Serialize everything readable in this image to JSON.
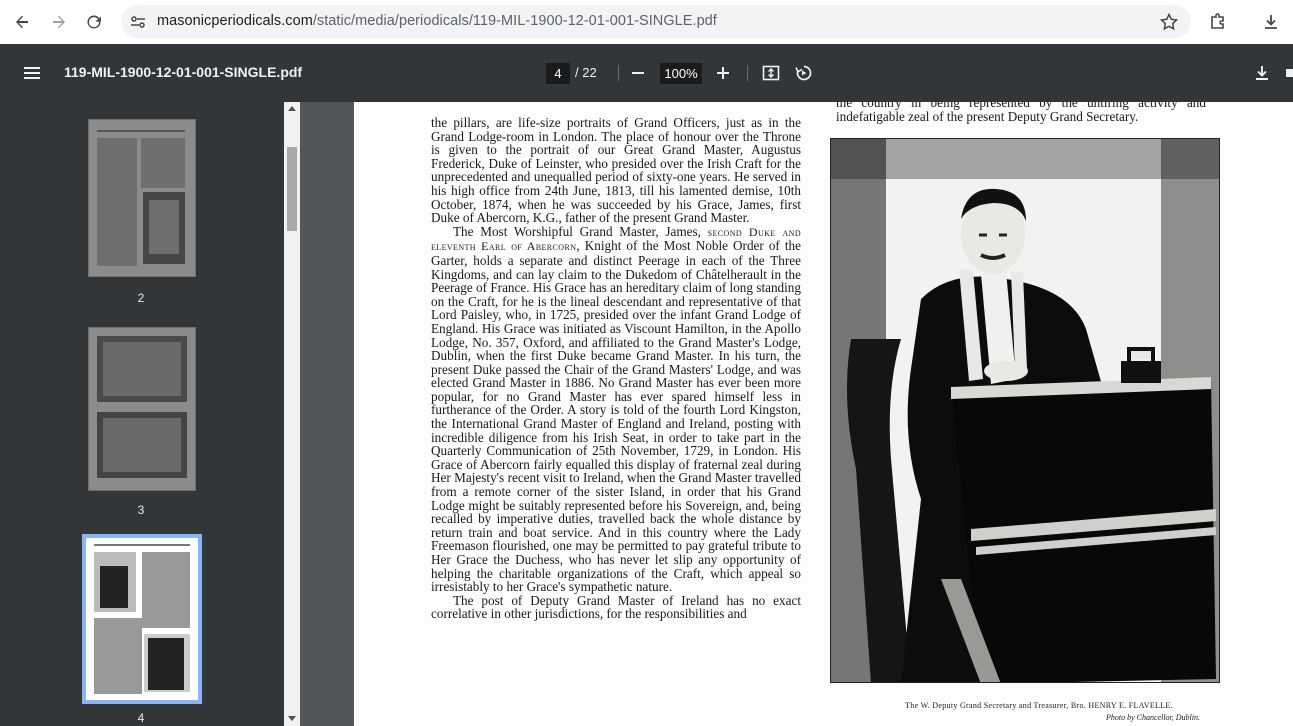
{
  "browser": {
    "url_host": "masonicperiodicals.com",
    "url_path": "/static/media/periodicals/119-MIL-1900-12-01-001-SINGLE.pdf"
  },
  "toolbar": {
    "title": "119-MIL-1900-12-01-001-SINGLE.pdf",
    "current_page": "4",
    "total_pages": "/ 22",
    "zoom": "100%"
  },
  "sidebar": {
    "thumbnails": [
      {
        "label": "2"
      },
      {
        "label": "3"
      },
      {
        "label": "4"
      }
    ]
  },
  "article": {
    "p1": "the pillars, are life-size portraits of Grand Officers, just as in the Grand Lodge-room in London. The place of honour over the Throne is given to the portrait of our Great Grand Master, Augustus Frederick, Duke of Leinster, who presided over the Irish Craft for the unprecedented and unequalled period of sixty-one years. He served in his high office from 24th June, 1813, till his lamented demise, 10th October, 1874, when he was succeeded by his Grace, James, first Duke of Abercorn, K.G., father of the present Grand Master.",
    "p2_start": "The Most Worshipful Grand Master, James, ",
    "p2_sc": "second Duke and eleventh Earl of Abercorn",
    "p2_rest": ", Knight of the Most Noble Order of the Garter, holds a separate and distinct Peerage in each of the Three Kingdoms, and can lay claim to the Dukedom of Châtelherault in the Peerage of France. His Grace has an hereditary claim of long standing on the Craft, for he is the lineal descendant and representative of that Lord Paisley, who, in 1725, presided over the infant Grand Lodge of England. His Grace was initiated as Viscount Hamilton, in the Apollo Lodge, No. 357, Oxford, and affiliated to the Grand Master's Lodge, Dublin, when the first Duke became Grand Master. In his turn, the present Duke passed the Chair of the Grand Masters' Lodge, and was elected Grand Master in 1886. No Grand Master has ever been more popular, for no Grand Master has ever spared himself less in furtherance of the Order. A story is told of the fourth Lord Kingston, the International Grand Master of England and Ireland, posting with incredible diligence from his Irish Seat, in order to take part in the Quarterly Communication of 25th November, 1729, in London. His Grace of Abercorn fairly equalled this display of fraternal zeal during Her Majesty's recent visit to Ireland, when the Grand Master travelled from a remote corner of the sister Island, in order that his Grand Lodge might be suitably represented before his Sovereign, and, being recalled by imperative duties, travelled back the whole distance by return train and boat service. And in this country where the Lady Freemason flourished, one may be permitted to pay grateful tribute to Her Grace the Duchess, who has never let slip any opportunity of helping the charitable organizations of the Craft, which appeal so irresistably to her Grace's sympathetic nature.",
    "p3": "The post of Deputy Grand Master of Ireland has no exact correlative in other jurisdictions, for the responsibilities and",
    "right_top": "the country in being represented by the untiring activity and indefatigable zeal of the present Deputy Grand Secretary.",
    "caption": "The W. Deputy Grand Secretary and Treasurer, Bro. HENRY E. FLAVELLE.",
    "credit": "Photo by Chancellor, Dublin."
  }
}
